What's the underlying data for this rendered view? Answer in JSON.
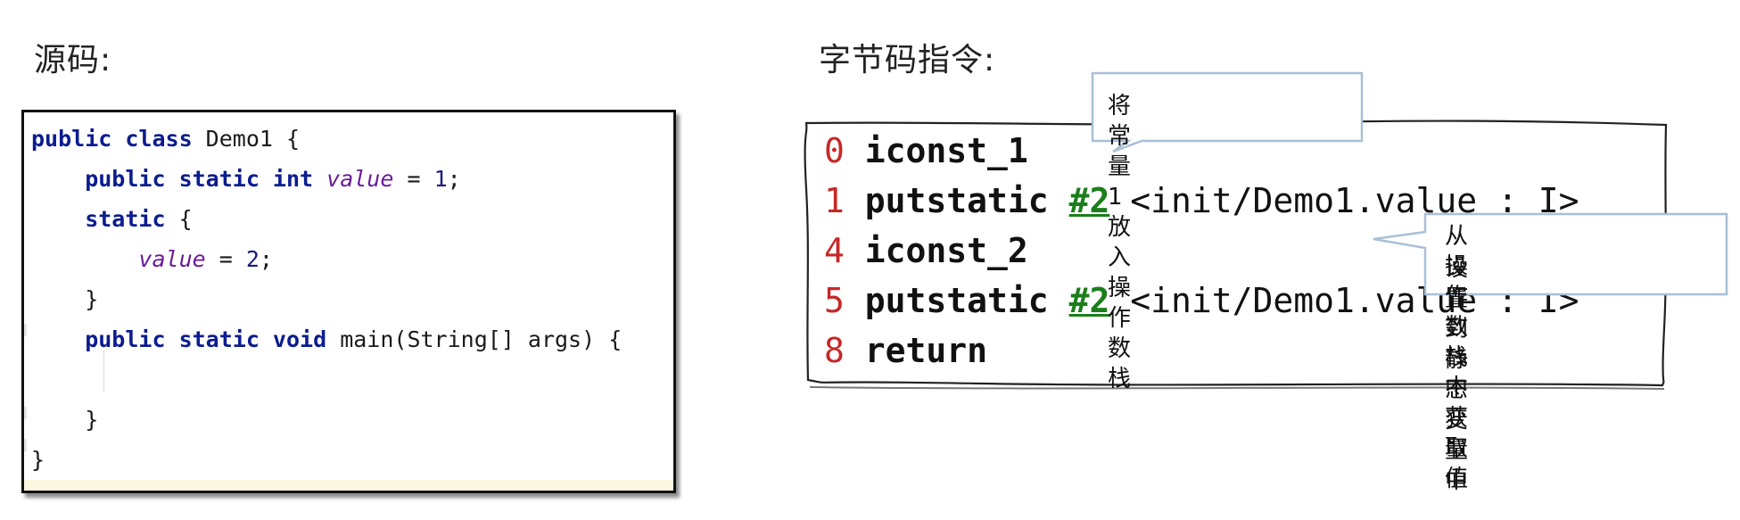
{
  "headings": {
    "source": "源码:",
    "bytecode": "字节码指令:"
  },
  "source_code": {
    "lines": [
      {
        "parts": [
          {
            "t": "public class ",
            "c": "kw"
          },
          {
            "t": "Demo1 {",
            "c": "plain"
          }
        ]
      },
      {
        "parts": [
          {
            "t": "    public static int ",
            "c": "kw"
          },
          {
            "t": "value",
            "c": "fld"
          },
          {
            "t": " = ",
            "c": "plain"
          },
          {
            "t": "1",
            "c": "num"
          },
          {
            "t": ";",
            "c": "plain"
          }
        ]
      },
      {
        "parts": [
          {
            "t": "    static ",
            "c": "kw"
          },
          {
            "t": "{",
            "c": "plain"
          }
        ]
      },
      {
        "parts": [
          {
            "t": "        ",
            "c": "plain"
          },
          {
            "t": "value",
            "c": "fld"
          },
          {
            "t": " = ",
            "c": "plain"
          },
          {
            "t": "2",
            "c": "num"
          },
          {
            "t": ";",
            "c": "plain"
          }
        ]
      },
      {
        "parts": [
          {
            "t": "    }",
            "c": "plain"
          }
        ]
      },
      {
        "parts": [
          {
            "t": "    public static void ",
            "c": "kw"
          },
          {
            "t": "main(String[] args) {",
            "c": "plain"
          }
        ]
      },
      {
        "parts": [
          {
            "t": "",
            "c": "plain"
          }
        ]
      },
      {
        "parts": [
          {
            "t": "    }",
            "c": "plain"
          }
        ]
      },
      {
        "parts": [
          {
            "t": "}",
            "c": "plain"
          }
        ]
      }
    ]
  },
  "bytecode": {
    "instructions": [
      {
        "offset": "0",
        "op": "iconst_1",
        "ref": "",
        "arg": ""
      },
      {
        "offset": "1",
        "op": "putstatic",
        "ref": "#2",
        "arg": "<init/Demo1.value : I>"
      },
      {
        "offset": "4",
        "op": "iconst_2",
        "ref": "",
        "arg": ""
      },
      {
        "offset": "5",
        "op": "putstatic",
        "ref": "#2",
        "arg": "<init/Demo1.value : I>"
      },
      {
        "offset": "8",
        "op": "return",
        "ref": "",
        "arg": ""
      }
    ]
  },
  "callouts": {
    "top": {
      "text": "将常量1放入操作数栈"
    },
    "right": {
      "line1": "从操作数栈中获取值",
      "line2": "设置到静态变量中"
    }
  },
  "colors": {
    "keyword": "#0b1c8f",
    "field": "#6a1b9a",
    "offset": "#c62828",
    "reference": "#1b7f1b",
    "callout_border": "#a9bfd6"
  }
}
